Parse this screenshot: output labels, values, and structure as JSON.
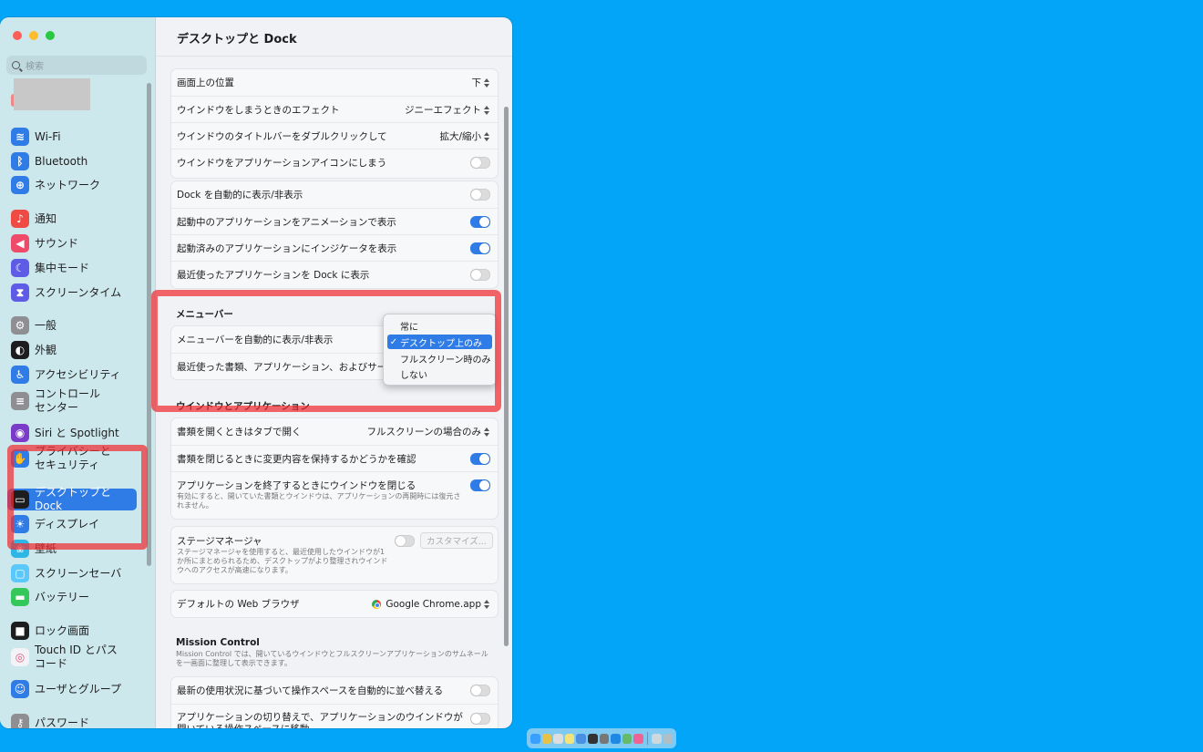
{
  "window_title": "デスクトップと Dock",
  "search": {
    "placeholder": "検索"
  },
  "sidebar": {
    "items": [
      {
        "label": "Wi-Fi",
        "icon": "wifi-icon",
        "color": "#2f7ce6"
      },
      {
        "label": "Bluetooth",
        "icon": "bluetooth-icon",
        "color": "#2f7ce6"
      },
      {
        "label": "ネットワーク",
        "icon": "network-icon",
        "color": "#2f7ce6"
      },
      {
        "label": "通知",
        "icon": "bell-icon",
        "color": "#f04a45"
      },
      {
        "label": "サウンド",
        "icon": "speaker-icon",
        "color": "#f04a6a"
      },
      {
        "label": "集中モード",
        "icon": "moon-icon",
        "color": "#5e5ce6"
      },
      {
        "label": "スクリーンタイム",
        "icon": "hourglass-icon",
        "color": "#5e5ce6"
      },
      {
        "label": "一般",
        "icon": "gear-icon",
        "color": "#8e8e93"
      },
      {
        "label": "外観",
        "icon": "appearance-icon",
        "color": "#1d1d1f"
      },
      {
        "label": "アクセシビリティ",
        "icon": "accessibility-icon",
        "color": "#2f7ce6"
      },
      {
        "label": "コントロール\nセンター",
        "icon": "control-center-icon",
        "color": "#8e8e93"
      },
      {
        "label": "Siri と Spotlight",
        "icon": "siri-icon",
        "color": "#7a3cc8"
      },
      {
        "label": "プライバシーと\nセキュリティ",
        "icon": "hand-icon",
        "color": "#2f7ce6"
      },
      {
        "label": "デスクトップと Dock",
        "icon": "dock-icon",
        "color": "#1d1d1f"
      },
      {
        "label": "ディスプレイ",
        "icon": "display-icon",
        "color": "#2f7ce6"
      },
      {
        "label": "壁紙",
        "icon": "wallpaper-icon",
        "color": "#2fb5e6"
      },
      {
        "label": "スクリーンセーバ",
        "icon": "screensaver-icon",
        "color": "#5ac8fa"
      },
      {
        "label": "バッテリー",
        "icon": "battery-icon",
        "color": "#34c759"
      },
      {
        "label": "ロック画面",
        "icon": "lock-icon",
        "color": "#1d1d1f"
      },
      {
        "label": "Touch ID とパス\nコード",
        "icon": "fingerprint-icon",
        "color": "#f2f2f7"
      },
      {
        "label": "ユーザとグループ",
        "icon": "users-icon",
        "color": "#2f7ce6"
      },
      {
        "label": "パスワード",
        "icon": "key-icon",
        "color": "#8e8e93"
      }
    ]
  },
  "dock_group": {
    "rows": [
      {
        "label": "画面上の位置",
        "value": "下",
        "control": "popup"
      },
      {
        "label": "ウインドウをしまうときのエフェクト",
        "value": "ジニーエフェクト",
        "control": "popup"
      },
      {
        "label": "ウインドウのタイトルバーをダブルクリックして",
        "value": "拡大/縮小",
        "control": "popup"
      },
      {
        "label": "ウインドウをアプリケーションアイコンにしまう",
        "control": "toggle",
        "on": false
      }
    ]
  },
  "dock_group2": {
    "rows": [
      {
        "label": "Dock を自動的に表示/非表示",
        "control": "toggle",
        "on": false
      },
      {
        "label": "起動中のアプリケーションをアニメーションで表示",
        "control": "toggle",
        "on": true
      },
      {
        "label": "起動済みのアプリケーションにインジケータを表示",
        "control": "toggle",
        "on": true
      },
      {
        "label": "最近使ったアプリケーションを Dock に表示",
        "control": "toggle",
        "on": false
      }
    ]
  },
  "menubar": {
    "section_title": "メニューバー",
    "rows": [
      {
        "label": "メニューバーを自動的に表示/非表示"
      },
      {
        "label": "最近使った書類、アプリケーション、およびサーバの"
      }
    ],
    "popup_options": [
      {
        "label": "常に",
        "checked": false
      },
      {
        "label": "デスクトップ上のみ",
        "checked": true
      },
      {
        "label": "フルスクリーン時のみ",
        "checked": false
      },
      {
        "label": "しない",
        "checked": false
      }
    ],
    "checkmark": "✓"
  },
  "windows_apps": {
    "section_title": "ウインドウとアプリケーション",
    "rows": [
      {
        "label": "書類を開くときはタブで開く",
        "value": "フルスクリーンの場合のみ",
        "control": "popup"
      },
      {
        "label": "書類を閉じるときに変更内容を保持するかどうかを確認",
        "control": "toggle",
        "on": true
      },
      {
        "label": "アプリケーションを終了するときにウインドウを閉じる",
        "control": "toggle",
        "on": true,
        "desc": "有効にすると、開いていた書類とウインドウは、アプリケーションの再開時には復元されません。"
      }
    ]
  },
  "stage_manager": {
    "label": "ステージマネージャ",
    "desc": "ステージマネージャを使用すると、最近使用したウインドウが1か所にまとめられるため、デスクトップがより整理されウインドウへのアクセスが高速になります。",
    "button": "カスタマイズ..."
  },
  "browser": {
    "label": "デフォルトの Web ブラウザ",
    "value": "Google Chrome.app"
  },
  "mission_control": {
    "section_title": "Mission Control",
    "desc": "Mission Control では、開いているウインドウとフルスクリーンアプリケーションのサムネールを一画面に整理して表示できます。",
    "rows": [
      {
        "label": "最新の使用状況に基づいて操作スペースを自動的に並べ替える",
        "control": "toggle",
        "on": false
      },
      {
        "label": "アプリケーションの切り替えで、アプリケーションのウインドウが開いている操作スペースに移動",
        "control": "toggle",
        "on": false
      }
    ]
  },
  "colors": {
    "accent": "#2f7ce6",
    "desktop": "#02a5f7",
    "highlight": "#f02d32"
  }
}
